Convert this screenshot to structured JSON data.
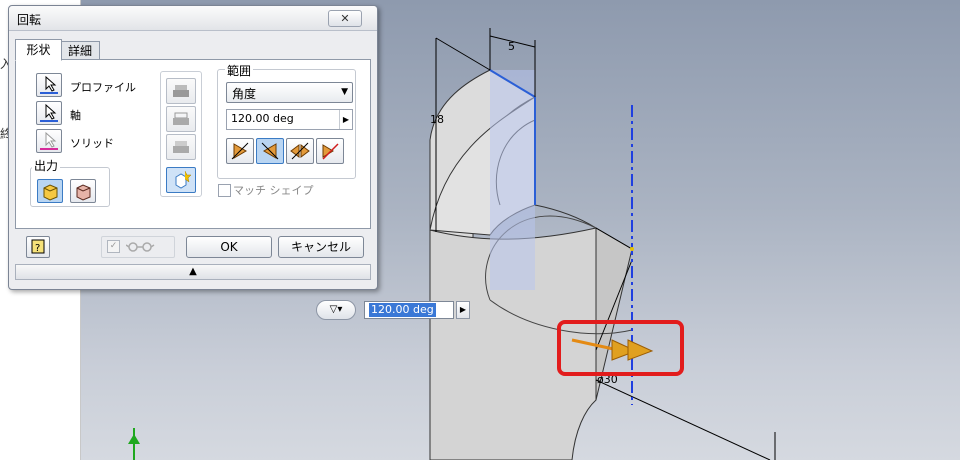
{
  "left_strip": {
    "chars": [
      "入",
      "終"
    ]
  },
  "viewport": {
    "dim_width": "5",
    "dim_height": "18",
    "dim_diameter": "ø30"
  },
  "dialog": {
    "title": "回転",
    "close_glyph": "✕",
    "tabs": [
      "形状",
      "詳細"
    ],
    "profile_label": "プロファイル",
    "axis_label": "軸",
    "solid_label": "ソリッド",
    "output_label": "出力",
    "range_label": "範囲",
    "range_type": "角度",
    "angle_value": "120.00 deg",
    "match_shape_label": "マッチ シェイプ",
    "ok_label": "OK",
    "cancel_label": "キャンセル",
    "help_glyph": "?",
    "expand_glyph": "▲",
    "colors": {
      "profile_underline": "#2b5fd6",
      "axis_underline": "#2b5fd6",
      "solid_underline": "#d52b9a"
    }
  },
  "mini_toolbar": {
    "value": "120.00 deg",
    "dropdown_glyph": "▽▾",
    "arrow_glyph": "▶"
  }
}
